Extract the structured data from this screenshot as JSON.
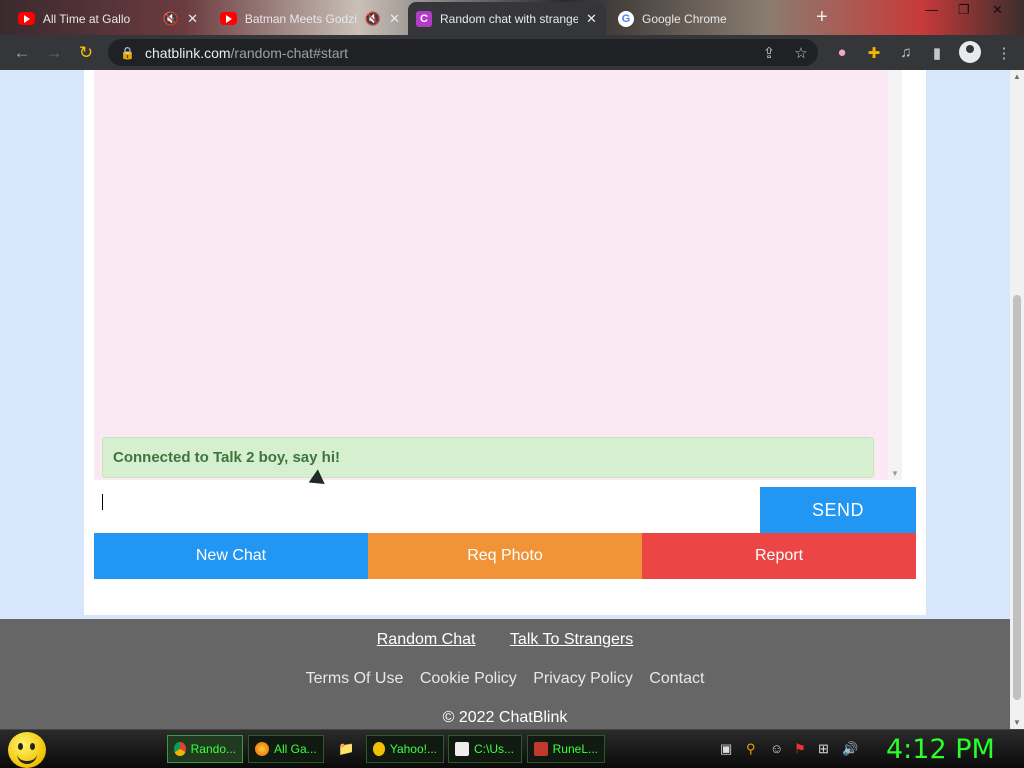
{
  "browser": {
    "tabs": [
      {
        "title": "All Time at Gallo",
        "icon": "youtube-icon"
      },
      {
        "title": "Batman Meets Godzilla",
        "icon": "youtube-icon"
      },
      {
        "title": "Random chat with strangers",
        "icon": "chatblink-icon",
        "favicon_letter": "C",
        "active": true
      },
      {
        "title": "Google Chrome",
        "icon": "google-icon",
        "favicon_letter": "G"
      }
    ],
    "url_host": "chatblink.com",
    "url_path": "/random-chat#start"
  },
  "chat": {
    "status_message": "Connected to Talk 2 boy, say hi!",
    "input_value": "",
    "send_label": "SEND",
    "new_chat_label": "New Chat",
    "req_photo_label": "Req Photo",
    "report_label": "Report"
  },
  "footer": {
    "links_primary": [
      "Random Chat",
      "Talk To Strangers"
    ],
    "links_secondary": [
      "Terms Of Use",
      "Cookie Policy",
      "Privacy Policy",
      "Contact"
    ],
    "copyright": "© 2022 ChatBlink"
  },
  "taskbar": {
    "items": [
      {
        "label": "Rando...",
        "icon": "chrome-icon"
      },
      {
        "label": "All Ga...",
        "icon": "firefox-icon"
      },
      {
        "label": "Yahoo!...",
        "icon": "yahoo-messenger-icon"
      },
      {
        "label": "C:\\Us...",
        "icon": "7zip-icon"
      },
      {
        "label": "RuneL...",
        "icon": "runelite-icon"
      }
    ],
    "clock": "4:12 PM"
  },
  "colors": {
    "blue": "#2196f3",
    "orange": "#f09437",
    "red": "#ec4545",
    "status_green_bg": "#d6efcf",
    "status_green_text": "#3c763d",
    "footer_bg": "#666666",
    "page_bg": "#d7e6fb"
  }
}
